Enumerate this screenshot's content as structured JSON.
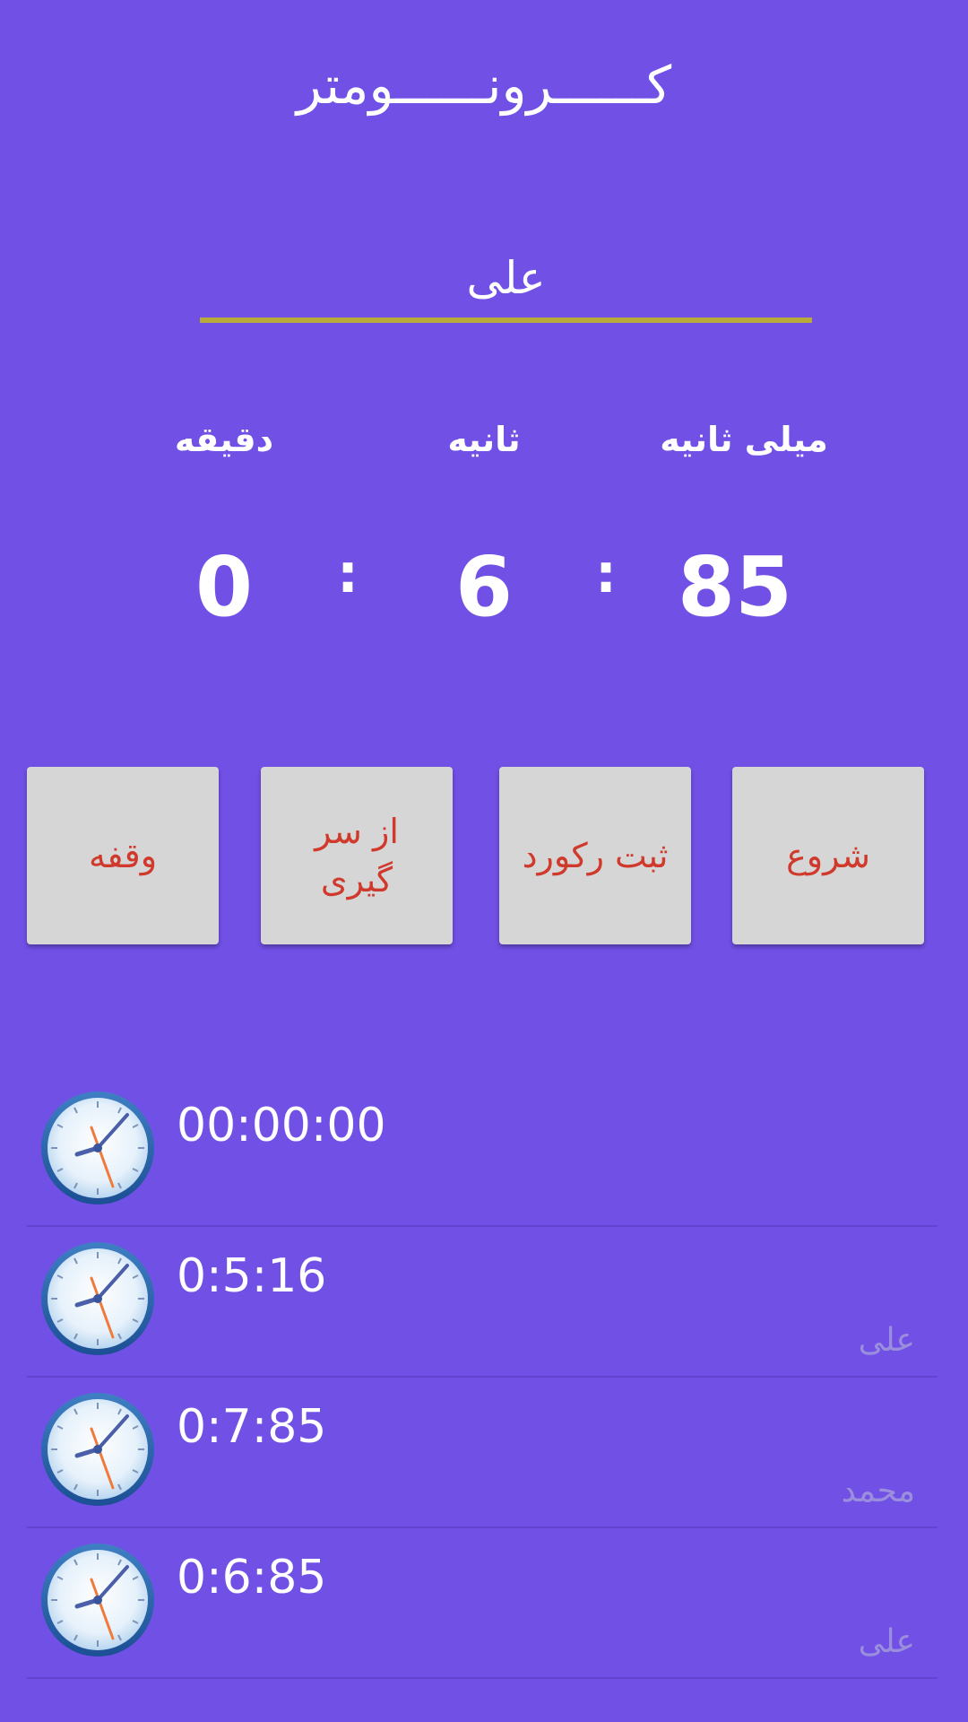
{
  "app": {
    "title": "كــــــرونــــــومتر"
  },
  "name_field": {
    "value": "على"
  },
  "timer": {
    "labels": {
      "minute": "دقيقه",
      "second": "ثانيه",
      "millisecond": "ميلى ثانيه"
    },
    "minute": "0",
    "second": "6",
    "millisecond": "85",
    "separator": ":"
  },
  "buttons": {
    "pause": "وقفه",
    "restart": "از سر گيرى",
    "save_record": "ثبت ركورد",
    "start": "شروع"
  },
  "records": [
    {
      "time": "00:00:00",
      "name": ""
    },
    {
      "time": "0:5:16",
      "name": "على"
    },
    {
      "time": "0:7:85",
      "name": "محمد"
    },
    {
      "time": "0:6:85",
      "name": "على"
    }
  ],
  "colors": {
    "background": "#7150e6",
    "underline": "#b8aa3a",
    "button_bg": "#d6d6d6",
    "button_text": "#d03a2c",
    "record_name": "#9b8edc"
  },
  "icons": {
    "record": "clock-icon"
  }
}
